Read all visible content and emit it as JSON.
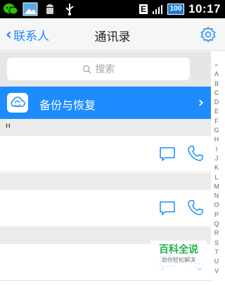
{
  "status_bar": {
    "time": "10:17",
    "battery": "100",
    "network": "E"
  },
  "nav": {
    "back_label": "联系人",
    "title": "通讯录"
  },
  "search": {
    "placeholder": "搜索"
  },
  "backup": {
    "label": "备份与恢复"
  },
  "section": {
    "header": "H"
  },
  "index_letters": [
    "Q",
    "A",
    "B",
    "C",
    "D",
    "E",
    "F",
    "G",
    "H",
    "I",
    "J",
    "K",
    "L",
    "M",
    "N",
    "O",
    "P",
    "Q",
    "R",
    "S",
    "T",
    "U",
    "V"
  ],
  "watermark": {
    "title": "百科全说",
    "subtitle": "助你轻松解决"
  },
  "colors": {
    "accent": "#1c8cff",
    "statusbar": "#000000",
    "watermark_green": "#23b34a"
  }
}
